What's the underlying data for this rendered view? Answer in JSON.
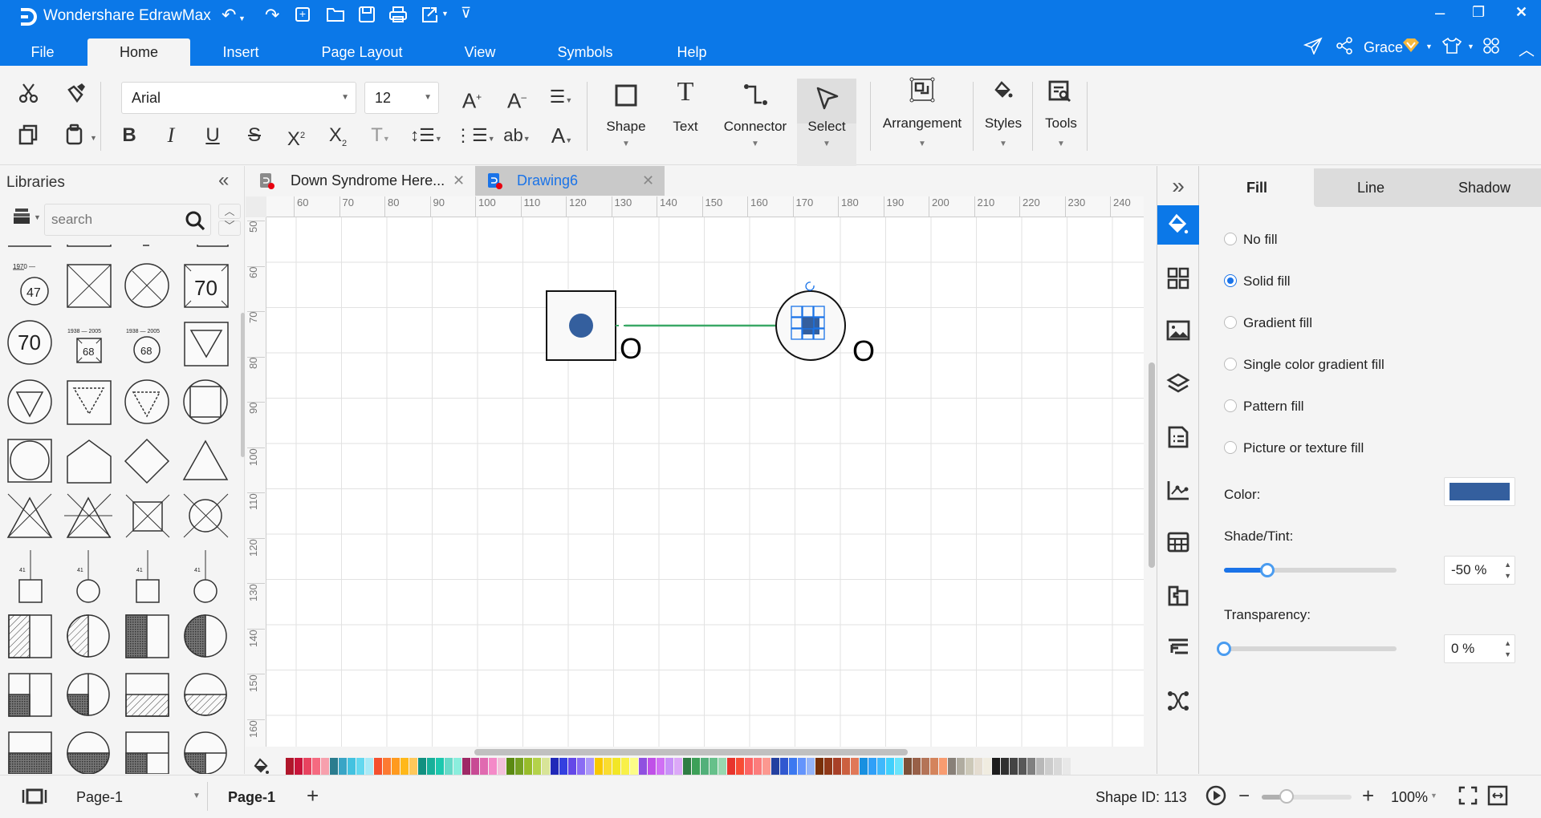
{
  "app": {
    "title": "Wondershare EdrawMax",
    "window_controls": {
      "minimize": "–",
      "restore": "❐",
      "close": "✕"
    }
  },
  "quick_access": [
    "undo-icon",
    "redo-icon",
    "new-icon",
    "open-icon",
    "save-icon",
    "print-icon",
    "export-icon",
    "customize-icon"
  ],
  "menu": {
    "tabs": [
      {
        "label": "File"
      },
      {
        "label": "Home",
        "active": true
      },
      {
        "label": "Insert"
      },
      {
        "label": "Page Layout"
      },
      {
        "label": "View"
      },
      {
        "label": "Symbols"
      },
      {
        "label": "Help"
      }
    ],
    "user": "Grace"
  },
  "ribbon": {
    "font_name": "Arial",
    "font_size": "12",
    "tools": {
      "shape": "Shape",
      "text": "Text",
      "connector": "Connector",
      "select": "Select",
      "arrangement": "Arrangement",
      "styles": "Styles",
      "tools": "Tools"
    }
  },
  "libraries": {
    "title": "Libraries",
    "search_placeholder": "search",
    "shape_texts": {
      "s47_year": "1970 —",
      "s47": "47",
      "s70": "70",
      "s68_years": "1938 — 2005",
      "s68": "68",
      "s41": "41"
    }
  },
  "documents": {
    "tabs": [
      {
        "label": "Down Syndrome Here...",
        "active": false
      },
      {
        "label": "Drawing6",
        "active": true
      }
    ]
  },
  "ruler": {
    "horizontal": [
      "60",
      "70",
      "80",
      "90",
      "100",
      "110",
      "120",
      "130",
      "140",
      "150",
      "160",
      "170",
      "180",
      "190",
      "200",
      "210",
      "220",
      "230",
      "240"
    ],
    "vertical": [
      "50",
      "60",
      "70",
      "80",
      "90",
      "100",
      "110",
      "120",
      "130",
      "140",
      "150",
      "160"
    ]
  },
  "canvas": {
    "shape_labels": [
      "O",
      "O"
    ],
    "fill_color": "#345f9e",
    "connector_color": "#3aa866",
    "selection_color": "#1a73e8"
  },
  "palette": [
    "#b0162b",
    "#c8143a",
    "#e8435f",
    "#f56a80",
    "#f7a0ad",
    "#2b7c8e",
    "#39a5c6",
    "#43c2e0",
    "#63d8ef",
    "#a8eaf7",
    "#f5502e",
    "#fd7a32",
    "#ff9a1e",
    "#ffb81a",
    "#ffc85a",
    "#119080",
    "#17b09a",
    "#1cc8ae",
    "#66dac8",
    "#8beedd",
    "#9e2a66",
    "#c84a94",
    "#e06ab0",
    "#f48ac8",
    "#f2c0da",
    "#5b8a12",
    "#74a022",
    "#98bc2a",
    "#b4d24a",
    "#d8e498",
    "#2028b8",
    "#3440e0",
    "#6448e8",
    "#8a6cf4",
    "#ac98f8",
    "#f8c800",
    "#fadc30",
    "#f2e626",
    "#f8f048",
    "#fcfc88",
    "#9050e0",
    "#c050e8",
    "#d070f4",
    "#c890f8",
    "#dca8f8",
    "#2f7d44",
    "#3da058",
    "#52b07a",
    "#66c08a",
    "#98d8b0",
    "#e8342c",
    "#f84c34",
    "#fc6464",
    "#fc7c7c",
    "#fc9890",
    "#2440a0",
    "#3058d0",
    "#3c78f0",
    "#6494fc",
    "#94b4f8",
    "#783008",
    "#903818",
    "#a84028",
    "#cc6040",
    "#e07858",
    "#1890e0",
    "#30a0f8",
    "#40b8fc",
    "#40d0fc",
    "#68e4fc",
    "#7c5038",
    "#986048",
    "#b47458",
    "#d4845c",
    "#f89c70",
    "#888078",
    "#b0aca0",
    "#ccc8b8",
    "#e4dcd0",
    "#f0ece0",
    "#1c1c1c",
    "#303030",
    "#444444",
    "#585858",
    "#808080",
    "#b8b8b8",
    "#cccccc",
    "#d8d8d8",
    "#e8e8e8"
  ],
  "right_rail": [
    "fill-icon",
    "grid-icon",
    "image-icon",
    "layers-icon",
    "notes-icon",
    "chart-icon",
    "table-icon",
    "puzzle-icon",
    "outline-icon",
    "mindmap-icon"
  ],
  "properties": {
    "tabs": [
      {
        "label": "Fill",
        "active": true
      },
      {
        "label": "Line"
      },
      {
        "label": "Shadow"
      }
    ],
    "fill_options": [
      {
        "label": "No fill",
        "checked": false
      },
      {
        "label": "Solid fill",
        "checked": true
      },
      {
        "label": "Gradient fill",
        "checked": false
      },
      {
        "label": "Single color gradient fill",
        "checked": false
      },
      {
        "label": "Pattern fill",
        "checked": false
      },
      {
        "label": "Picture or texture fill",
        "checked": false
      }
    ],
    "color_label": "Color:",
    "color_value": "#345f9e",
    "shade_label": "Shade/Tint:",
    "shade_value": "-50 %",
    "shade_fraction": 0.25,
    "transparency_label": "Transparency:",
    "transparency_value": "0 %",
    "transparency_fraction": 0.0
  },
  "status": {
    "page_selector": "Page-1",
    "current_page": "Page-1",
    "add_page": "+",
    "shape_id": "Shape ID: 113",
    "zoom": "100%",
    "zoom_fraction": 0.28
  }
}
